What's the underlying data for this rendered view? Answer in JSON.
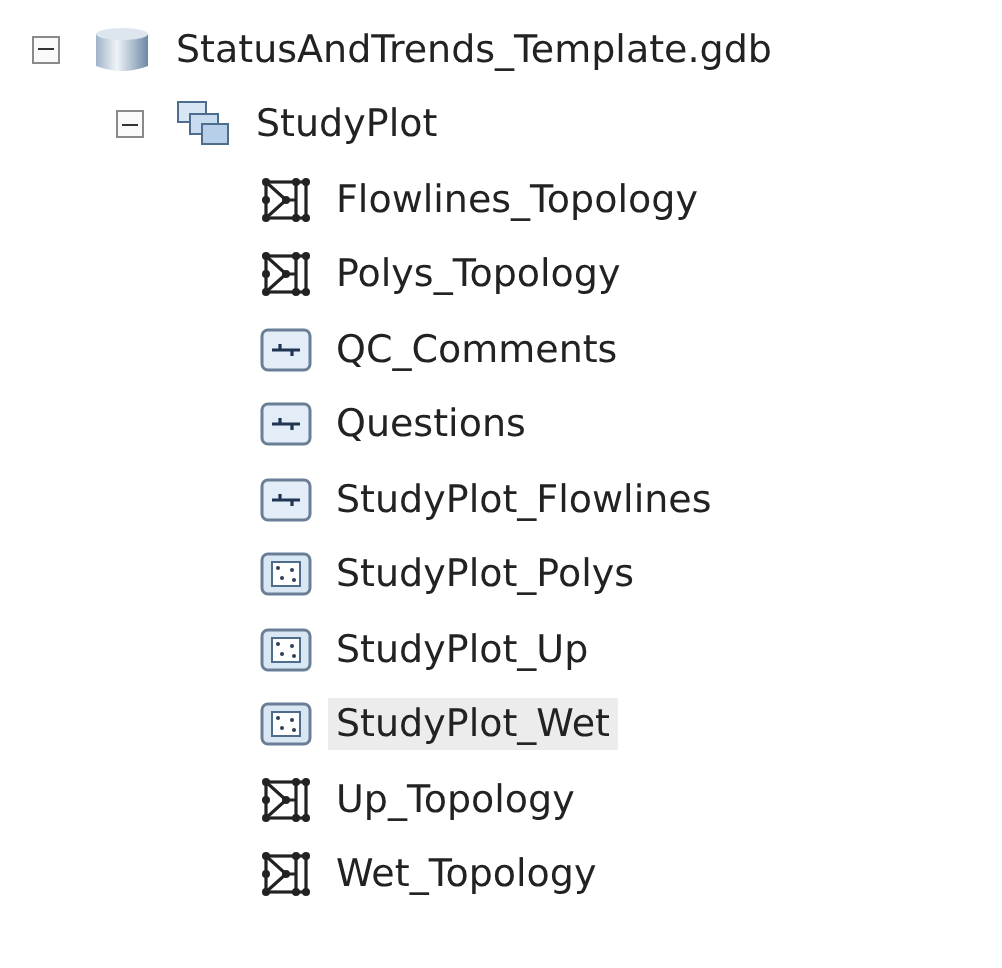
{
  "tree": {
    "label": "StatusAndTrends_Template.gdb",
    "kind": "database",
    "expanded": true,
    "children": [
      {
        "label": "StudyPlot",
        "kind": "dataset",
        "expanded": true,
        "children": [
          {
            "label": "Flowlines_Topology",
            "kind": "topology",
            "selected": false
          },
          {
            "label": "Polys_Topology",
            "kind": "topology",
            "selected": false
          },
          {
            "label": "QC_Comments",
            "kind": "table",
            "selected": false
          },
          {
            "label": "Questions",
            "kind": "table",
            "selected": false
          },
          {
            "label": "StudyPlot_Flowlines",
            "kind": "table",
            "selected": false
          },
          {
            "label": "StudyPlot_Polys",
            "kind": "polygon",
            "selected": false
          },
          {
            "label": "StudyPlot_Up",
            "kind": "polygon",
            "selected": false
          },
          {
            "label": "StudyPlot_Wet",
            "kind": "polygon",
            "selected": true
          },
          {
            "label": "Up_Topology",
            "kind": "topology",
            "selected": false
          },
          {
            "label": "Wet_Topology",
            "kind": "topology",
            "selected": false
          }
        ]
      }
    ]
  }
}
